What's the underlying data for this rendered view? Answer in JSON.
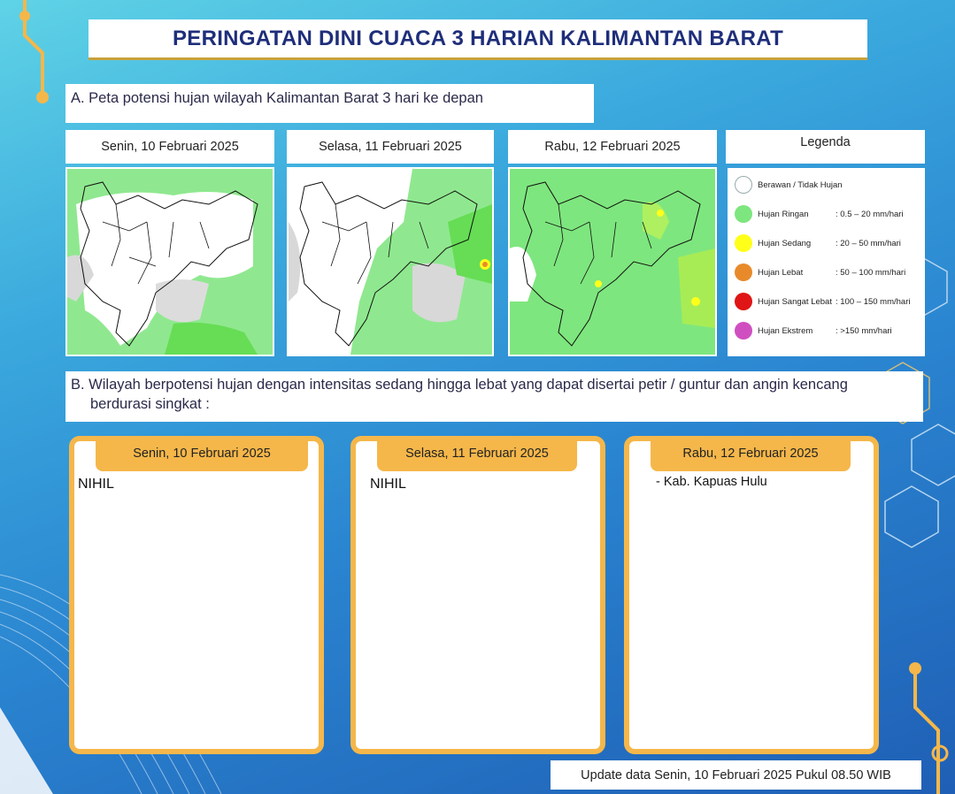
{
  "title": "PERINGATAN DINI CUACA 3 HARIAN KALIMANTAN BARAT",
  "section_a": {
    "label": "A. Peta potensi hujan wilayah Kalimantan Barat 3 hari ke depan",
    "maps": [
      {
        "date": "Senin, 10 Februari 2025"
      },
      {
        "date": "Selasa, 11 Februari 2025"
      },
      {
        "date": "Rabu, 12 Februari 2025"
      }
    ]
  },
  "legend": {
    "title": "Legenda",
    "items": [
      {
        "name": "Berawan / Tidak Hujan",
        "range": "",
        "color": "#ffffff"
      },
      {
        "name": "Hujan Ringan",
        "range": ": 0.5 – 20 mm/hari",
        "color": "#7ee67e"
      },
      {
        "name": "Hujan Sedang",
        "range": ": 20 – 50 mm/hari",
        "color": "#ffff1a"
      },
      {
        "name": "Hujan Lebat",
        "range": ": 50 – 100 mm/hari",
        "color": "#e88a2a"
      },
      {
        "name": "Hujan Sangat Lebat",
        "range": ": 100 – 150 mm/hari",
        "color": "#e01515"
      },
      {
        "name": "Hujan Ekstrem",
        "range": ": >150 mm/hari",
        "color": "#d04fc0"
      }
    ]
  },
  "section_b": {
    "line1": "B. Wilayah berpotensi hujan dengan intensitas sedang hingga lebat yang dapat disertai petir / guntur dan angin kencang",
    "line2": "berdurasi singkat :",
    "days": [
      {
        "date": "Senin, 10 Februari 2025",
        "content": "NIHIL"
      },
      {
        "date": "Selasa, 11 Februari 2025",
        "content": "NIHIL"
      },
      {
        "date": "Rabu, 12 Februari 2025",
        "content": "- Kab. Kapuas Hulu"
      }
    ]
  },
  "update": "Update data Senin, 10 Februari 2025 Pukul 08.50 WIB",
  "colors": {
    "accent": "#f5b74a",
    "title": "#1f2e7a",
    "rain_light": "#7ee67e"
  }
}
